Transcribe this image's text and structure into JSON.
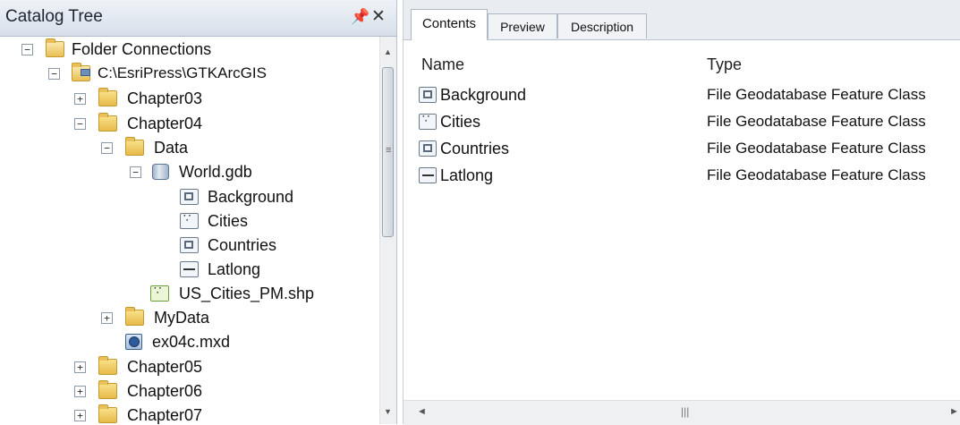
{
  "catalog": {
    "title": "Catalog Tree",
    "pin_glyph": "📌",
    "close_glyph": "✕",
    "nodes": [
      {
        "label": "Folder Connections",
        "expander": "−",
        "icon": "folder-connections-icon"
      },
      {
        "label": "C:\\EsriPress\\GTKArcGIS",
        "expander": "−",
        "icon": "folder-connection-icon"
      },
      {
        "label": "Chapter03",
        "expander": "+",
        "icon": "folder-icon"
      },
      {
        "label": "Chapter04",
        "expander": "−",
        "icon": "folder-icon"
      },
      {
        "label": "Data",
        "expander": "−",
        "icon": "folder-icon"
      },
      {
        "label": "World.gdb",
        "expander": "−",
        "icon": "geodatabase-icon"
      },
      {
        "label": "Background",
        "icon": "polygon-feature-class-icon"
      },
      {
        "label": "Cities",
        "icon": "point-feature-class-icon"
      },
      {
        "label": "Countries",
        "icon": "polygon-feature-class-icon"
      },
      {
        "label": "Latlong",
        "icon": "line-feature-class-icon"
      },
      {
        "label": "US_Cities_PM.shp",
        "icon": "shapefile-icon"
      },
      {
        "label": "MyData",
        "expander": "+",
        "icon": "folder-icon"
      },
      {
        "label": "ex04c.mxd",
        "icon": "map-document-icon"
      },
      {
        "label": "Chapter05",
        "expander": "+",
        "icon": "folder-icon"
      },
      {
        "label": "Chapter06",
        "expander": "+",
        "icon": "folder-icon"
      },
      {
        "label": "Chapter07",
        "expander": "+",
        "icon": "folder-icon"
      }
    ]
  },
  "contents": {
    "tabs": [
      {
        "label": "Contents",
        "active": true
      },
      {
        "label": "Preview",
        "active": false
      },
      {
        "label": "Description",
        "active": false
      }
    ],
    "columns": {
      "name": "Name",
      "type": "Type"
    },
    "rows": [
      {
        "name": "Background",
        "type": "File Geodatabase Feature Class",
        "icon": "polygon-feature-class-icon"
      },
      {
        "name": "Cities",
        "type": "File Geodatabase Feature Class",
        "icon": "point-feature-class-icon"
      },
      {
        "name": "Countries",
        "type": "File Geodatabase Feature Class",
        "icon": "polygon-feature-class-icon"
      },
      {
        "name": "Latlong",
        "type": "File Geodatabase Feature Class",
        "icon": "line-feature-class-icon"
      }
    ]
  },
  "colors": {
    "title_bar": "#dfe6ee",
    "folder": "#f0cf6a",
    "tab_strip": "#e9edf2"
  }
}
